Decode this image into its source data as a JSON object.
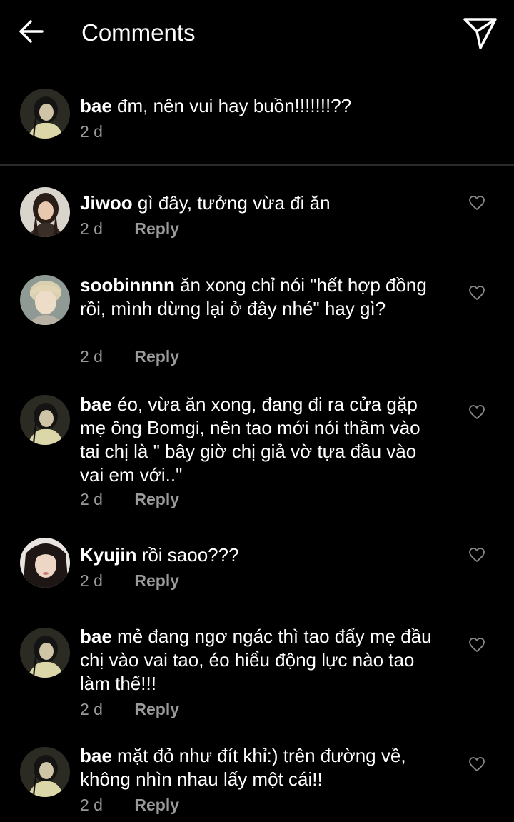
{
  "header": {
    "title": "Comments"
  },
  "caption": {
    "username": "bae",
    "text": "đm, nên vui hay buồn!!!!!!!??",
    "time": "2 d"
  },
  "comments": [
    {
      "username": "Jiwoo",
      "text": "gì đây, tưởng vừa đi ăn",
      "time": "2 d",
      "reply_label": "Reply"
    },
    {
      "username": "soobinnnn",
      "text": "ăn xong chỉ nói \"hết hợp đồng rồi, mình dừng lại ở đây nhé\" hay gì?",
      "time": "2 d",
      "reply_label": "Reply"
    },
    {
      "username": "bae",
      "text": "éo, vừa ăn xong, đang đi ra cửa gặp mẹ ông Bomgi, nên tao mới nói thầm vào tai chị là \" bây giờ chị giả vờ tựa đầu vào vai em với..\"",
      "time": "2 d",
      "reply_label": "Reply"
    },
    {
      "username": "Kyujin",
      "text": "rồi saoo???",
      "time": "2 d",
      "reply_label": "Reply"
    },
    {
      "username": "bae",
      "text": "mẻ đang ngơ ngác thì tao đẩy mẹ đầu chị vào vai tao, éo hiểu động lực nào tao làm thế!!!",
      "time": "2 d",
      "reply_label": "Reply"
    },
    {
      "username": "bae",
      "text": "mặt đỏ như đít khỉ:) trên đường về, không nhìn nhau lấy một cái!!",
      "time": "2 d",
      "reply_label": "Reply"
    }
  ],
  "icons": {
    "back": "arrow-left-icon",
    "share": "paper-plane-icon",
    "like": "heart-outline-icon"
  },
  "colors": {
    "background": "#000000",
    "text": "#ffffff",
    "muted": "#9a9a9a",
    "divider": "#2a2a2a"
  }
}
